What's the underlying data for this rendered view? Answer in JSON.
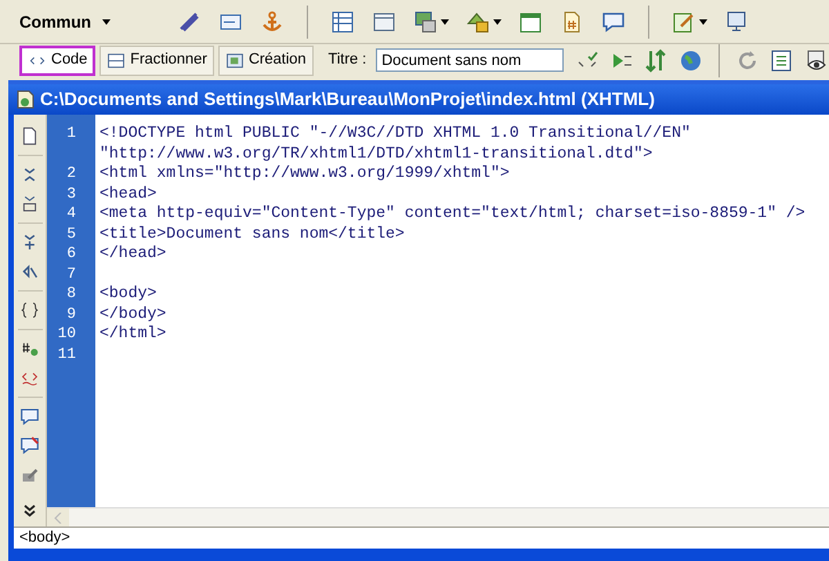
{
  "insert_bar": {
    "category": "Commun"
  },
  "document_toolbar": {
    "views": [
      {
        "label": "Code",
        "selected": true
      },
      {
        "label": "Fractionner",
        "selected": false
      },
      {
        "label": "Création",
        "selected": false
      }
    ],
    "title_label": "Titre :",
    "title_value": "Document sans nom"
  },
  "document_window": {
    "title": "C:\\Documents and Settings\\Mark\\Bureau\\MonProjet\\index.html (XHTML)"
  },
  "code_lines": [
    {
      "number": "1",
      "text": "<!DOCTYPE html PUBLIC \"-//W3C//DTD XHTML 1.0 Transitional//EN\""
    },
    {
      "text": "\"http://www.w3.org/TR/xhtml1/DTD/xhtml1-transitional.dtd\">"
    },
    {
      "number": "2",
      "text": "<html xmlns=\"http://www.w3.org/1999/xhtml\">"
    },
    {
      "number": "3",
      "text": "<head>"
    },
    {
      "number": "4",
      "text": "<meta http-equiv=\"Content-Type\" content=\"text/html; charset=iso-8859-1\" />"
    },
    {
      "number": "5",
      "text": "<title>Document sans nom</title>"
    },
    {
      "number": "6",
      "text": "</head>"
    },
    {
      "number": "7"
    },
    {
      "number": "8",
      "text": "<body>"
    },
    {
      "number": "9",
      "text": "</body>"
    },
    {
      "number": "10",
      "text": "</html>"
    },
    {
      "number": "11"
    }
  ],
  "status_bar": {
    "tag": "<body>"
  }
}
